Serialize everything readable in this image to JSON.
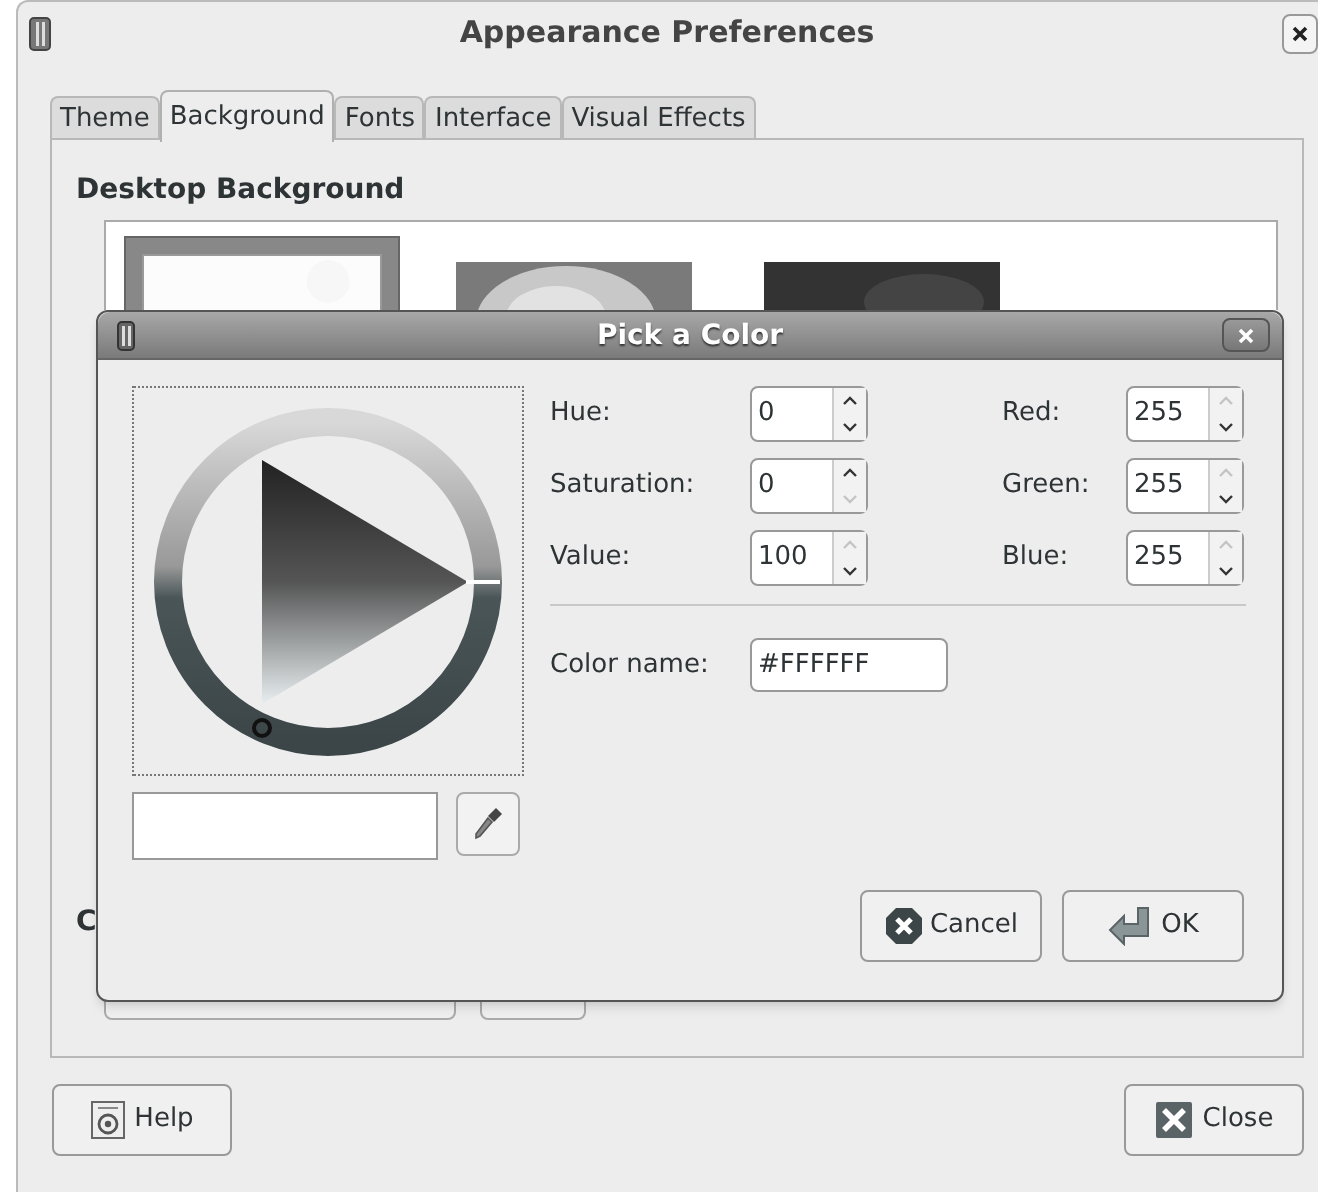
{
  "window": {
    "title": "Appearance Preferences"
  },
  "tabs": [
    {
      "label": "Theme",
      "selected": false
    },
    {
      "label": "Background",
      "selected": true
    },
    {
      "label": "Fonts",
      "selected": false
    },
    {
      "label": "Interface",
      "selected": false
    },
    {
      "label": "Visual Effects",
      "selected": false
    }
  ],
  "background": {
    "heading": "Desktop Background",
    "thumbnails": [
      {
        "kind": "picture",
        "selected": true
      },
      {
        "kind": "picture",
        "selected": false
      },
      {
        "kind": "picture",
        "selected": false
      }
    ],
    "section_label": "C"
  },
  "dialog": {
    "title": "Pick a Color",
    "hsv": [
      {
        "label": "Hue:",
        "value": "0",
        "up_disabled": false,
        "down_disabled": false
      },
      {
        "label": "Saturation:",
        "value": "0",
        "up_disabled": false,
        "down_disabled": true
      },
      {
        "label": "Value:",
        "value": "100",
        "up_disabled": true,
        "down_disabled": false
      }
    ],
    "rgb": [
      {
        "label": "Red:",
        "value": "255",
        "up_disabled": true,
        "down_disabled": false
      },
      {
        "label": "Green:",
        "value": "255",
        "up_disabled": true,
        "down_disabled": false
      },
      {
        "label": "Blue:",
        "value": "255",
        "up_disabled": true,
        "down_disabled": false
      }
    ],
    "color_name": {
      "label": "Color name:",
      "value": "#FFFFFF"
    },
    "buttons": [
      {
        "kind": "cancel",
        "label": "Cancel"
      },
      {
        "kind": "ok",
        "label": "OK"
      }
    ]
  },
  "buttons": [
    {
      "kind": "help",
      "label": "Help"
    },
    {
      "kind": "close",
      "label": "Close"
    }
  ]
}
